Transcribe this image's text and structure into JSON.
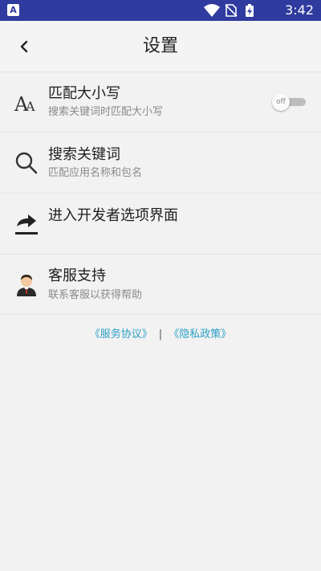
{
  "status_bar": {
    "app_badge": "A",
    "time": "3:42",
    "icons": [
      "wifi-icon",
      "no-sim-icon",
      "battery-charging-icon"
    ]
  },
  "header": {
    "title": "设置",
    "back_icon": "chevron-left-icon"
  },
  "settings": [
    {
      "id": "match-case",
      "icon": "font-case-icon",
      "label": "匹配大小写",
      "sub": "搜索关键词时匹配大小写",
      "toggle": {
        "state": "off",
        "label": "off"
      }
    },
    {
      "id": "search-keyword",
      "icon": "search-icon",
      "label": "搜索关键词",
      "sub": "匹配应用名称和包名"
    },
    {
      "id": "developer-options",
      "icon": "share-arrow-icon",
      "label": "进入开发者选项界面"
    },
    {
      "id": "customer-service",
      "icon": "customer-service-avatar-icon",
      "label": "客服支持",
      "sub": "联系客服以获得帮助"
    }
  ],
  "footer": {
    "terms": "《服务协议》",
    "separator": "|",
    "privacy": "《隐私政策》"
  },
  "colors": {
    "status_bar": "#2f3b9e",
    "background": "#f2f2f2",
    "link": "#2a9fc7"
  }
}
